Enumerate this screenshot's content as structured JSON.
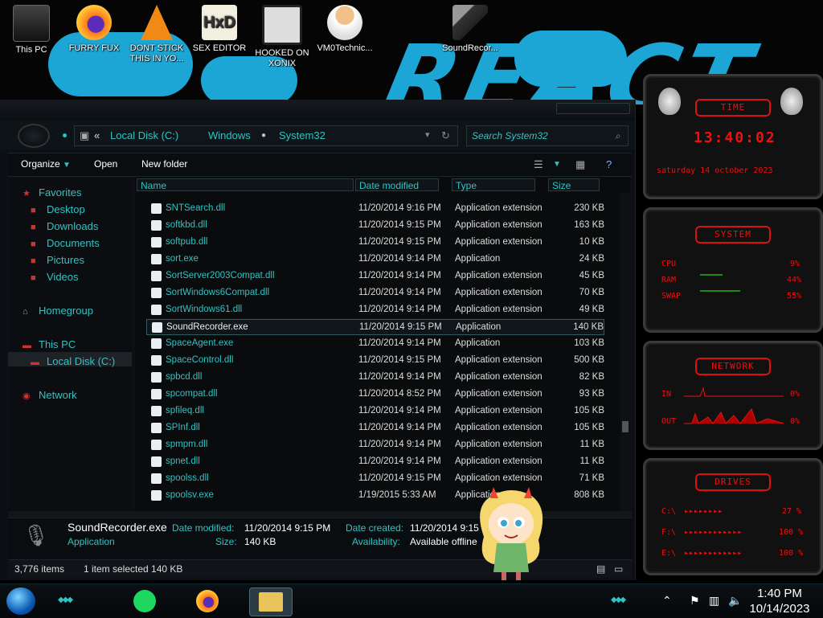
{
  "desktop": {
    "icons": [
      {
        "label": "This PC"
      },
      {
        "label": "FURRY FUX"
      },
      {
        "label": "DONT STICK THIS IN YO..."
      },
      {
        "label": "SEX EDITOR"
      },
      {
        "label": "HOOKED ON XONIX"
      },
      {
        "label": "VM0Technic..."
      },
      {
        "label": "SoundRecor..."
      }
    ]
  },
  "explorer": {
    "breadcrumb": [
      "«",
      "Local Disk (C:)",
      "Windows",
      "System32"
    ],
    "search_placeholder": "Search System32",
    "toolbar": {
      "organize": "Organize",
      "open": "Open",
      "new_folder": "New folder"
    },
    "nav": {
      "favorites": "Favorites",
      "desktop": "Desktop",
      "downloads": "Downloads",
      "documents": "Documents",
      "pictures": "Pictures",
      "videos": "Videos",
      "homegroup": "Homegroup",
      "this_pc": "This PC",
      "local_disk": "Local Disk (C:)",
      "network": "Network"
    },
    "columns": {
      "name": "Name",
      "date": "Date modified",
      "type": "Type",
      "size": "Size"
    },
    "files": [
      {
        "name": "SNTSearch.dll",
        "date": "11/20/2014 9:16 PM",
        "type": "Application extension",
        "size": "230 KB"
      },
      {
        "name": "softkbd.dll",
        "date": "11/20/2014 9:15 PM",
        "type": "Application extension",
        "size": "163 KB"
      },
      {
        "name": "softpub.dll",
        "date": "11/20/2014 9:15 PM",
        "type": "Application extension",
        "size": "10 KB"
      },
      {
        "name": "sort.exe",
        "date": "11/20/2014 9:14 PM",
        "type": "Application",
        "size": "24 KB"
      },
      {
        "name": "SortServer2003Compat.dll",
        "date": "11/20/2014 9:14 PM",
        "type": "Application extension",
        "size": "45 KB"
      },
      {
        "name": "SortWindows6Compat.dll",
        "date": "11/20/2014 9:14 PM",
        "type": "Application extension",
        "size": "70 KB"
      },
      {
        "name": "SortWindows61.dll",
        "date": "11/20/2014 9:14 PM",
        "type": "Application extension",
        "size": "49 KB"
      },
      {
        "name": "SoundRecorder.exe",
        "date": "11/20/2014 9:15 PM",
        "type": "Application",
        "size": "140 KB"
      },
      {
        "name": "SpaceAgent.exe",
        "date": "11/20/2014 9:14 PM",
        "type": "Application",
        "size": "103 KB"
      },
      {
        "name": "SpaceControl.dll",
        "date": "11/20/2014 9:15 PM",
        "type": "Application extension",
        "size": "500 KB"
      },
      {
        "name": "spbcd.dll",
        "date": "11/20/2014 9:14 PM",
        "type": "Application extension",
        "size": "82 KB"
      },
      {
        "name": "spcompat.dll",
        "date": "11/20/2014 8:52 PM",
        "type": "Application extension",
        "size": "93 KB"
      },
      {
        "name": "spfileq.dll",
        "date": "11/20/2014 9:14 PM",
        "type": "Application extension",
        "size": "105 KB"
      },
      {
        "name": "SPInf.dll",
        "date": "11/20/2014 9:14 PM",
        "type": "Application extension",
        "size": "105 KB"
      },
      {
        "name": "spmpm.dll",
        "date": "11/20/2014 9:14 PM",
        "type": "Application extension",
        "size": "11 KB"
      },
      {
        "name": "spnet.dll",
        "date": "11/20/2014 9:14 PM",
        "type": "Application extension",
        "size": "11 KB"
      },
      {
        "name": "spoolss.dll",
        "date": "11/20/2014 9:15 PM",
        "type": "Application extension",
        "size": "71 KB"
      },
      {
        "name": "spoolsv.exe",
        "date": "1/19/2015 5:33 AM",
        "type": "Application",
        "size": "808 KB"
      }
    ],
    "details": {
      "name": "SoundRecorder.exe",
      "kind": "Application",
      "date_modified_label": "Date modified:",
      "date_modified": "11/20/2014 9:15 PM",
      "size_label": "Size:",
      "size": "140 KB",
      "date_created_label": "Date created:",
      "date_created": "11/20/2014 9:15 PM",
      "availability_label": "Availability:",
      "availability": "Available offline"
    },
    "status": {
      "items": "3,776 items",
      "selected": "1 item selected  140 KB"
    }
  },
  "gadgets": {
    "time": {
      "title": "TIME",
      "clock": "13:40:02",
      "date": "saturday 14 october 2023"
    },
    "system": {
      "title": "SYSTEM",
      "cpu_label": "CPU",
      "cpu": "9%",
      "ram_label": "RAM",
      "ram": "44%",
      "swap_label": "SWAP",
      "swap": "55%"
    },
    "network": {
      "title": "NETWORK",
      "in_label": "IN",
      "in": "0%",
      "out_label": "OUT",
      "out": "0%"
    },
    "drives": {
      "title": "DRIVES",
      "items": [
        {
          "label": "C:\\",
          "value": "27 %"
        },
        {
          "label": "F:\\",
          "value": "100 %"
        },
        {
          "label": "E:\\",
          "value": "100 %"
        }
      ]
    }
  },
  "taskbar": {
    "time": "1:40 PM",
    "date": "10/14/2023"
  },
  "colors": {
    "accent": "#2ec4c4",
    "gadget_red": "#e11111",
    "wallpaper_blue": "#1ba6d6"
  }
}
